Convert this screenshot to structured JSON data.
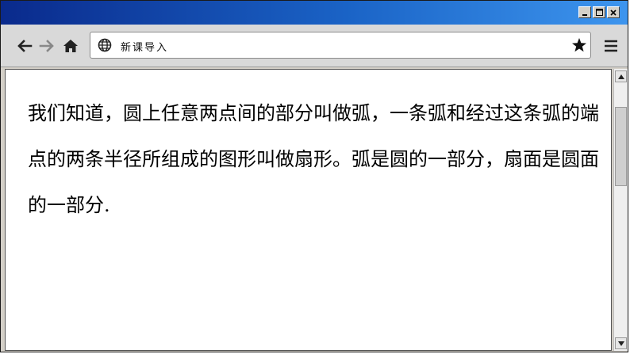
{
  "window": {
    "controls": {
      "minimize_icon": "minimize-icon",
      "maximize_icon": "maximize-icon",
      "close_icon": "close-icon"
    }
  },
  "toolbar": {
    "back_icon": "arrow-left-icon",
    "forward_icon": "arrow-right-icon",
    "home_icon": "home-icon",
    "address": {
      "icon": "globe-icon",
      "text": "新课导入"
    },
    "bookmark_icon": "star-icon",
    "menu_icon": "hamburger-icon"
  },
  "page": {
    "paragraph": "我们知道，圆上任意两点间的部分叫做弧，一条弧和经过这条弧的端点的两条半径所组成的图形叫做扇形。弧是圆的一部分，扇面是圆面的一部分."
  },
  "colors": {
    "titlebar_start": "#0a2a8c",
    "titlebar_end": "#3d95ee",
    "toolbar_bg": "#d9d9d9",
    "content_bg": "#ffffff"
  }
}
